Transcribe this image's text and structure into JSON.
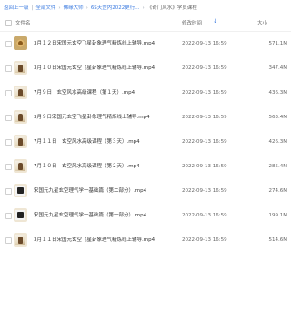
{
  "breadcrumb": {
    "items": [
      "返回上一级",
      "全部文件",
      "佛缘大师",
      "6S天罡内2022更行...",
      "《奇门风水》学员课程"
    ]
  },
  "header": {
    "name_label": "文件名",
    "time_label": "修改时间",
    "sort_icon": "↓",
    "size_label": "大小"
  },
  "files": [
    {
      "name": "3月１２日宋国元玄空飞星卦象理气精炼线上辅导.mp4",
      "time": "2022-09-13 16:59",
      "size": "571.1M",
      "thumb": "audio-icon"
    },
    {
      "name": "3月１０日宋国元玄空飞星卦象理气精炼线上辅导.mp4",
      "time": "2022-09-13 16:59",
      "size": "347.4M",
      "thumb": "image-thumb"
    },
    {
      "name": "7月９日　玄空风水高级课程（第１天）.mp4",
      "time": "2022-09-13 16:59",
      "size": "436.3M",
      "thumb": "image-thumb"
    },
    {
      "name": "3月９日宋国元玄空飞星卦象理气精炼线上辅导.mp4",
      "time": "2022-09-13 16:59",
      "size": "563.4M",
      "thumb": "image-thumb"
    },
    {
      "name": "7月１１日　玄空风水高级课程（第３天）.mp4",
      "time": "2022-09-13 16:59",
      "size": "426.3M",
      "thumb": "image-thumb"
    },
    {
      "name": "7月１０日　玄空风水高级课程（第２天）.mp4",
      "time": "2022-09-13 16:59",
      "size": "285.4M",
      "thumb": "image-thumb"
    },
    {
      "name": "宋国元九星玄空理气学一基础篇（第二部分）.mp4",
      "time": "2022-09-13 16:59",
      "size": "274.6M",
      "thumb": "video-thumb"
    },
    {
      "name": "宋国元九星玄空理气学一基础篇（第一部分）.mp4",
      "time": "2022-09-13 16:59",
      "size": "199.1M",
      "thumb": "video-thumb"
    },
    {
      "name": "3月１１日宋国元玄空飞星卦象理气精炼线上辅导.mp4",
      "time": "2022-09-13 16:59",
      "size": "514.6M",
      "thumb": "image-thumb"
    }
  ]
}
